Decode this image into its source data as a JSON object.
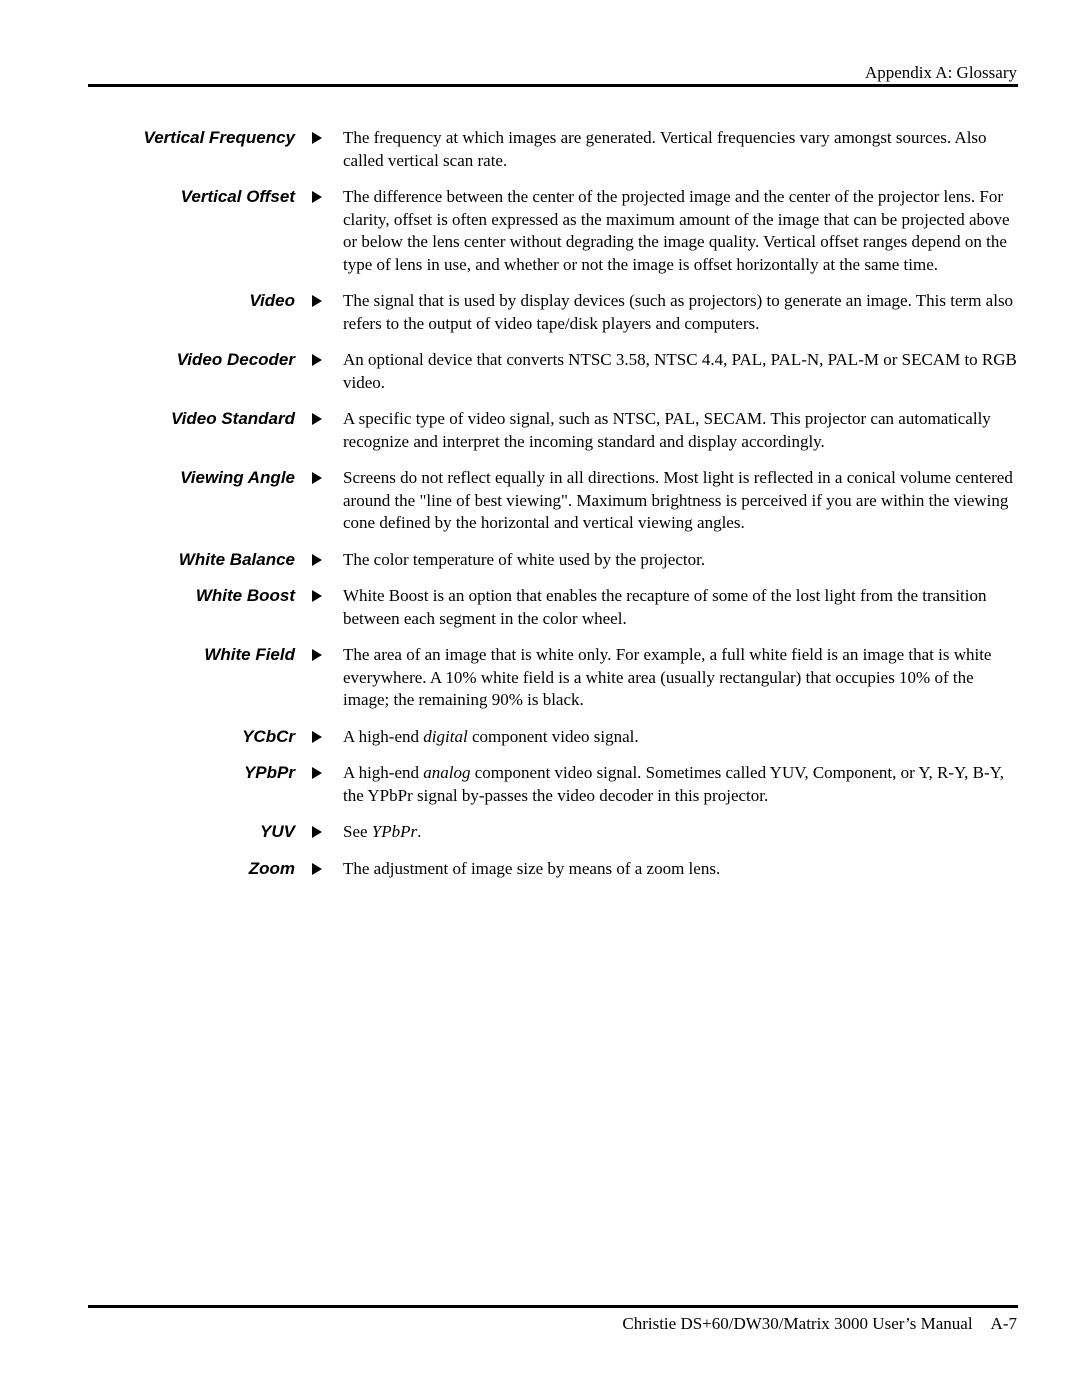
{
  "header": {
    "title": "Appendix A: Glossary"
  },
  "footer": {
    "manual_title": "Christie DS+60/DW30/Matrix 3000 User’s Manual",
    "page_number": "A-7"
  },
  "entries": [
    {
      "term": "Vertical Frequency",
      "definition": "The frequency at which images are generated. Vertical frequencies vary amongst sources. Also called vertical scan rate."
    },
    {
      "term": "Vertical Offset",
      "definition": "The difference between the center of the projected image and the center of the projector lens. For clarity, offset is often expressed as the maximum amount of the image that can be projected above or below the lens center without degrading the image quality. Vertical offset ranges depend on the type of lens in use, and whether or not the image is offset horizontally at the same time."
    },
    {
      "term": "Video",
      "definition": "The signal that is used by display devices (such as projectors) to generate an image. This term also refers to the output of video tape/disk players and computers."
    },
    {
      "term": "Video Decoder",
      "definition": "An optional device that converts NTSC 3.58, NTSC 4.4, PAL, PAL-N, PAL-M or SECAM to RGB video."
    },
    {
      "term": "Video Standard",
      "definition": "A specific type of video signal, such as NTSC, PAL, SECAM. This projector can automatically recognize and interpret the incoming standard and display accordingly."
    },
    {
      "term": "Viewing Angle",
      "definition": "Screens do not reflect equally in all directions. Most light is reflected in a conical volume centered around the \"line of best viewing\". Maximum brightness is perceived if you are within the viewing cone defined by the horizontal and vertical viewing angles."
    },
    {
      "term": "White Balance",
      "definition": "The color temperature of white used by the projector."
    },
    {
      "term": "White Boost",
      "definition": "White Boost is an option that enables the recapture of some of the lost light from the transition between each segment in the color wheel."
    },
    {
      "term": "White Field",
      "definition": "The area of an image that is white only. For example, a full white field is an image that is white everywhere. A 10% white field is a white area (usually rectangular) that occupies 10% of the image; the remaining 90% is black."
    },
    {
      "term": "YCbCr",
      "definition_parts": [
        "A high-end ",
        "digital",
        " component video signal."
      ]
    },
    {
      "term": "YPbPr",
      "definition_parts": [
        "A high-end ",
        "analog",
        " component video signal. Sometimes called YUV, Component, or Y, R-Y, B-Y, the YPbPr signal by-passes the video decoder in this projector."
      ]
    },
    {
      "term": "YUV",
      "definition_parts": [
        "See ",
        "YPbPr",
        "."
      ]
    },
    {
      "term": "Zoom",
      "definition": "The adjustment of image size by means of a zoom lens."
    }
  ],
  "icons": {
    "entry_marker": "triangle-right-icon"
  }
}
